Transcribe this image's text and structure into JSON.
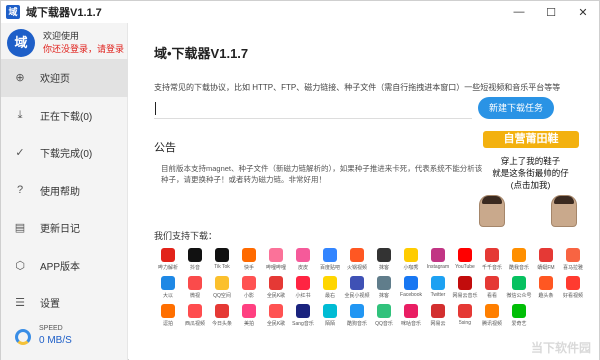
{
  "window": {
    "title": "域下载器V1.1.7",
    "icon_text": "域",
    "controls": {
      "minimize": "—",
      "maximize": "☐",
      "close": "✕"
    }
  },
  "sidebar": {
    "avatar_text": "域",
    "welcome": "欢迎使用",
    "login_hint": "你还没登录，请登录",
    "items": [
      {
        "label": "欢迎页",
        "icon": "plus-circle-icon",
        "glyph": "⊕",
        "active": true
      },
      {
        "label": "正在下载(0)",
        "icon": "download-icon",
        "glyph": "⤓",
        "active": false
      },
      {
        "label": "下载完成(0)",
        "icon": "check-circle-icon",
        "glyph": "✓",
        "active": false
      },
      {
        "label": "使用帮助",
        "icon": "help-icon",
        "glyph": "?",
        "active": false
      },
      {
        "label": "更新日记",
        "icon": "log-icon",
        "glyph": "▤",
        "active": false
      },
      {
        "label": "APP版本",
        "icon": "cube-icon",
        "glyph": "⬡",
        "active": false
      },
      {
        "label": "设置",
        "icon": "settings-icon",
        "glyph": "☰",
        "active": false
      }
    ],
    "speed_label": "SPEED",
    "speed_value": "0 MB/S"
  },
  "main": {
    "title": "域•下载器V1.1.7",
    "protocol_desc": "支持常见的下载协议，比如 HTTP、FTP、磁力链接、种子文件（需自行拖拽进本窗口）一些短视频和音乐平台等等",
    "url_input": {
      "value": "",
      "placeholder": ""
    },
    "new_task_label": "新建下载任务",
    "notice_title": "公告",
    "notice_text": "目前版本支持magnet、种子文件（新磁力链解析的），如果种子推进来卡死，代表系统不能分析该种子，请更换种子！或者转为磁力链。非常好用！",
    "ad": {
      "banner": "自营莆田鞋",
      "line1": "穿上了我的鞋子",
      "line2": "就是这条街最帅的仔",
      "line3": "(点击加我)"
    },
    "support_label": "我们支持下载：",
    "watermark": "当下软件园"
  },
  "apps": [
    {
      "name": "哔力解析",
      "color": "#e2231a"
    },
    {
      "name": "抖音",
      "color": "#111111"
    },
    {
      "name": "Tik Tok",
      "color": "#111111"
    },
    {
      "name": "快手",
      "color": "#ff6a00"
    },
    {
      "name": "哔哩哔哩",
      "color": "#fb7299"
    },
    {
      "name": "皮皮",
      "color": "#f55a9a"
    },
    {
      "name": "百度贴吧",
      "color": "#3385ff"
    },
    {
      "name": "火锅视频",
      "color": "#ff5722"
    },
    {
      "name": "抹客",
      "color": "#333333"
    },
    {
      "name": "小咖秀",
      "color": "#ffcc00"
    },
    {
      "name": "Instagram",
      "color": "#c13584"
    },
    {
      "name": "YouTube",
      "color": "#ff0000"
    },
    {
      "name": "千千音乐",
      "color": "#e53935"
    },
    {
      "name": "酷我音乐",
      "color": "#ff8f00"
    },
    {
      "name": "蜻蜓FM",
      "color": "#e53935"
    },
    {
      "name": "喜马拉雅",
      "color": "#f86442"
    },
    {
      "name": "大以",
      "color": "#1e88e5"
    },
    {
      "name": "微视",
      "color": "#fa4b4b"
    },
    {
      "name": "QQ空间",
      "color": "#fbc02d"
    },
    {
      "name": "小影",
      "color": "#ff5252"
    },
    {
      "name": "全民K歌",
      "color": "#e53935"
    },
    {
      "name": "小红书",
      "color": "#ff2442"
    },
    {
      "name": "最右",
      "color": "#ffd600"
    },
    {
      "name": "全民小视频",
      "color": "#3f51b5"
    },
    {
      "name": "抹客",
      "color": "#607d8b"
    },
    {
      "name": "Facebook",
      "color": "#1877f2"
    },
    {
      "name": "Twitter",
      "color": "#1da1f2"
    },
    {
      "name": "网易云音乐",
      "color": "#c20c0c"
    },
    {
      "name": "看看",
      "color": "#e53935"
    },
    {
      "name": "微信公众号",
      "color": "#07c160"
    },
    {
      "name": "趣头条",
      "color": "#ff5722"
    },
    {
      "name": "好看视频",
      "color": "#ff3b30"
    },
    {
      "name": "逗拍",
      "color": "#ff6f00"
    },
    {
      "name": "西瓜视频",
      "color": "#ff4d4f"
    },
    {
      "name": "今日头条",
      "color": "#e53935"
    },
    {
      "name": "美拍",
      "color": "#ff4081"
    },
    {
      "name": "全民K歌",
      "color": "#ff5252"
    },
    {
      "name": "Sang音乐",
      "color": "#1a237e"
    },
    {
      "name": "陌陌",
      "color": "#00bcd4"
    },
    {
      "name": "酷狗音乐",
      "color": "#2196f3"
    },
    {
      "name": "QQ音乐",
      "color": "#31c27c"
    },
    {
      "name": "咪咕音乐",
      "color": "#e91e63"
    },
    {
      "name": "网易云",
      "color": "#d32f2f"
    },
    {
      "name": "5sing",
      "color": "#e53935"
    },
    {
      "name": "腾讯视频",
      "color": "#ff7f00"
    },
    {
      "name": "爱奇艺",
      "color": "#00be06"
    }
  ]
}
